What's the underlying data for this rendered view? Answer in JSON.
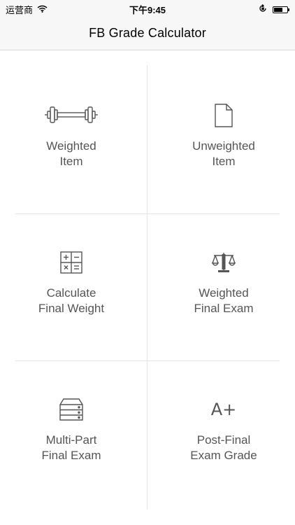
{
  "status_bar": {
    "carrier": "运营商",
    "time": "下午9:45"
  },
  "nav": {
    "title": "FB Grade Calculator"
  },
  "menu": [
    {
      "label": "Weighted\nItem",
      "icon": "dumbbell-icon"
    },
    {
      "label": "Unweighted\nItem",
      "icon": "document-icon"
    },
    {
      "label": "Calculate\nFinal Weight",
      "icon": "calculator-icon"
    },
    {
      "label": "Weighted\nFinal Exam",
      "icon": "scales-icon"
    },
    {
      "label": "Multi-Part\nFinal Exam",
      "icon": "stacked-drawers-icon"
    },
    {
      "label": "Post-Final\nExam Grade",
      "icon": "a-plus-icon",
      "icon_text": "A+"
    }
  ],
  "colors": {
    "text": "#555555",
    "bar_bg": "#f7f7f7",
    "divider": "#e4e4e4"
  }
}
